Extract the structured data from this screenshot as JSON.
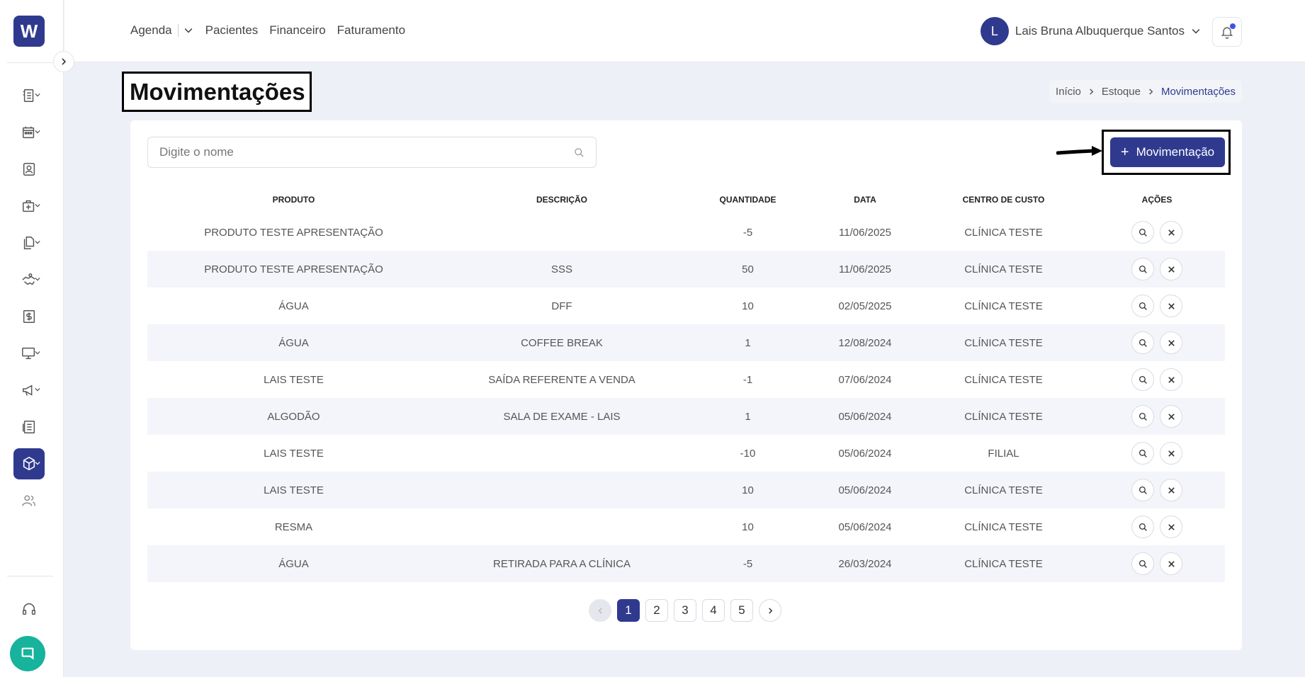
{
  "app": {
    "logo_letter": "W",
    "brand_color": "#2f3a8f",
    "page_bg": "#eef0f8"
  },
  "topnav": {
    "items": [
      "Agenda",
      "Pacientes",
      "Financeiro",
      "Faturamento"
    ]
  },
  "user": {
    "initial": "L",
    "name": "Lais Bruna Albuquerque Santos"
  },
  "page": {
    "title": "Movimentações"
  },
  "breadcrumb": {
    "items": [
      "Início",
      "Estoque",
      "Movimentações"
    ]
  },
  "search": {
    "placeholder": "Digite o nome",
    "value": ""
  },
  "actions": {
    "add_label": "Movimentação"
  },
  "table": {
    "headers": [
      "PRODUTO",
      "DESCRIÇÃO",
      "QUANTIDADE",
      "DATA",
      "CENTRO DE CUSTO",
      "AÇÕES"
    ],
    "rows": [
      [
        "PRODUTO TESTE APRESENTAÇÃO",
        "",
        "-5",
        "11/06/2025",
        "CLÍNICA TESTE"
      ],
      [
        "PRODUTO TESTE APRESENTAÇÃO",
        "SSS",
        "50",
        "11/06/2025",
        "CLÍNICA TESTE"
      ],
      [
        "ÁGUA",
        "DFF",
        "10",
        "02/05/2025",
        "CLÍNICA TESTE"
      ],
      [
        "ÁGUA",
        "COFFEE BREAK",
        "1",
        "12/08/2024",
        "CLÍNICA TESTE"
      ],
      [
        "LAIS TESTE",
        "SAÍDA REFERENTE A VENDA",
        "-1",
        "07/06/2024",
        "CLÍNICA TESTE"
      ],
      [
        "ALGODÃO",
        "SALA DE EXAME - LAIS",
        "1",
        "05/06/2024",
        "CLÍNICA TESTE"
      ],
      [
        "LAIS TESTE",
        "",
        "-10",
        "05/06/2024",
        "FILIAL"
      ],
      [
        "LAIS TESTE",
        "",
        "10",
        "05/06/2024",
        "CLÍNICA TESTE"
      ],
      [
        "RESMA",
        "",
        "10",
        "05/06/2024",
        "CLÍNICA TESTE"
      ],
      [
        "ÁGUA",
        "RETIRADA PARA A CLÍNICA",
        "-5",
        "26/03/2024",
        "CLÍNICA TESTE"
      ]
    ]
  },
  "pagination": {
    "pages": [
      "1",
      "2",
      "3",
      "4",
      "5"
    ],
    "current": "1"
  },
  "sidebar": {
    "icons": [
      "records-icon",
      "calendar-icon",
      "patient-card-icon",
      "medical-bag-icon",
      "documents-icon",
      "handshake-icon",
      "dollar-icon",
      "monitor-icon",
      "megaphone-icon",
      "report-icon",
      "box-icon",
      "users-icon"
    ],
    "active": "box-icon",
    "bottom": [
      "headset-icon",
      "chat-icon"
    ]
  }
}
